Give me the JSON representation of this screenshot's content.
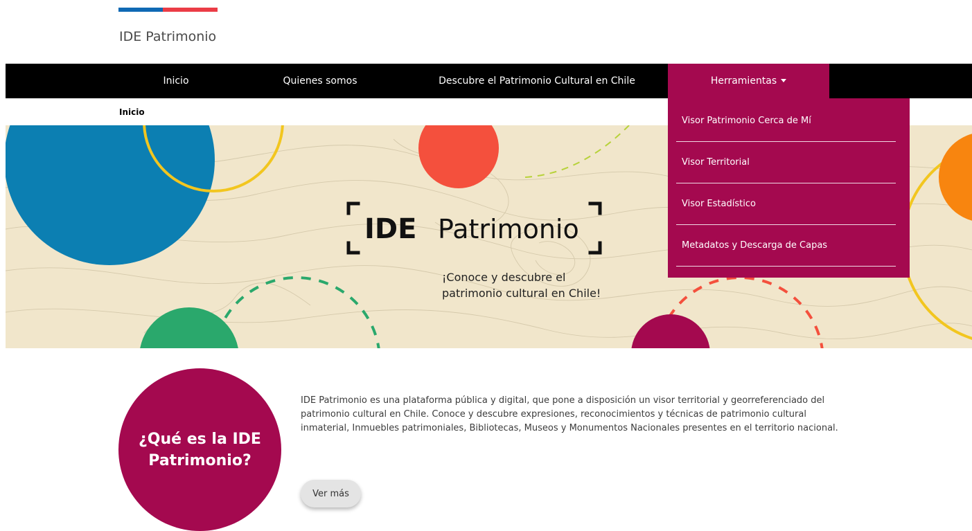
{
  "header": {
    "site_title": "IDE Patrimonio",
    "flag_colors": {
      "blue": "#0f69b4",
      "red": "#eb3c46"
    }
  },
  "nav": {
    "items": [
      {
        "label": "Inicio"
      },
      {
        "label": "Quienes somos"
      },
      {
        "label": "Descubre el Patrimonio Cultural en Chile"
      },
      {
        "label": "Herramientas",
        "active": true
      }
    ],
    "bar_color": "#000000",
    "active_color": "#a4094f"
  },
  "dropdown": {
    "items": [
      {
        "label": "Visor Patrimonio Cerca de Mí"
      },
      {
        "label": "Visor Territorial"
      },
      {
        "label": "Visor Estadístico"
      },
      {
        "label": "Metadatos y Descarga de Capas"
      }
    ],
    "color": "#a4094f"
  },
  "breadcrumb": {
    "current": "Inicio"
  },
  "banner": {
    "logo_bold": "IDE",
    "logo_text": "Patrimonio",
    "tagline_line1": "¡Conoce y descubre el",
    "tagline_line2": "patrimonio cultural en Chile!",
    "colors": {
      "background": "#f1e6cb",
      "blue": "#0c7fb2",
      "yellow": "#f2c61f",
      "red": "#f4503d",
      "green": "#2aa86c",
      "magenta": "#a4094f",
      "orange": "#f8850f"
    }
  },
  "about": {
    "title": "¿Qué es la IDE Patrimonio?",
    "description": "IDE Patrimonio es una plataforma pública y digital, que pone a disposición un visor territorial y georreferenciado del patrimonio cultural en Chile. Conoce y descubre expresiones, reconocimientos y técnicas de patrimonio cultural inmaterial, Inmuebles patrimoniales, Bibliotecas, Museos y Monumentos Nacionales presentes en el territorio nacional.",
    "button_label": "Ver más",
    "circle_color": "#a4094f"
  }
}
